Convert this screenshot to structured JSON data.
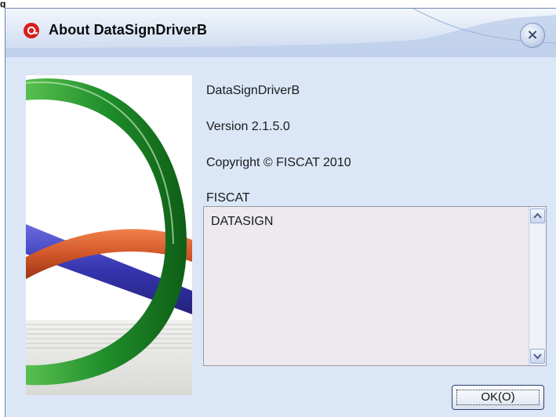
{
  "window": {
    "title": "About DataSignDriverB",
    "close_label": "×"
  },
  "info": {
    "product_name": "DataSignDriverB",
    "version": "Version 2.1.5.0",
    "copyright": "Copyright © FISCAT 2010",
    "company": "FISCAT"
  },
  "description": {
    "text": "DATASIGN"
  },
  "buttons": {
    "ok_label": "OK(O)"
  },
  "background": {
    "fragment": "g"
  },
  "colors": {
    "green_ring": "#1f8d2a",
    "blue_band": "#3f3fb8",
    "orange_band": "#d2572a",
    "window_bg": "#dbe6f7",
    "app_icon_red": "#d81e1e"
  }
}
